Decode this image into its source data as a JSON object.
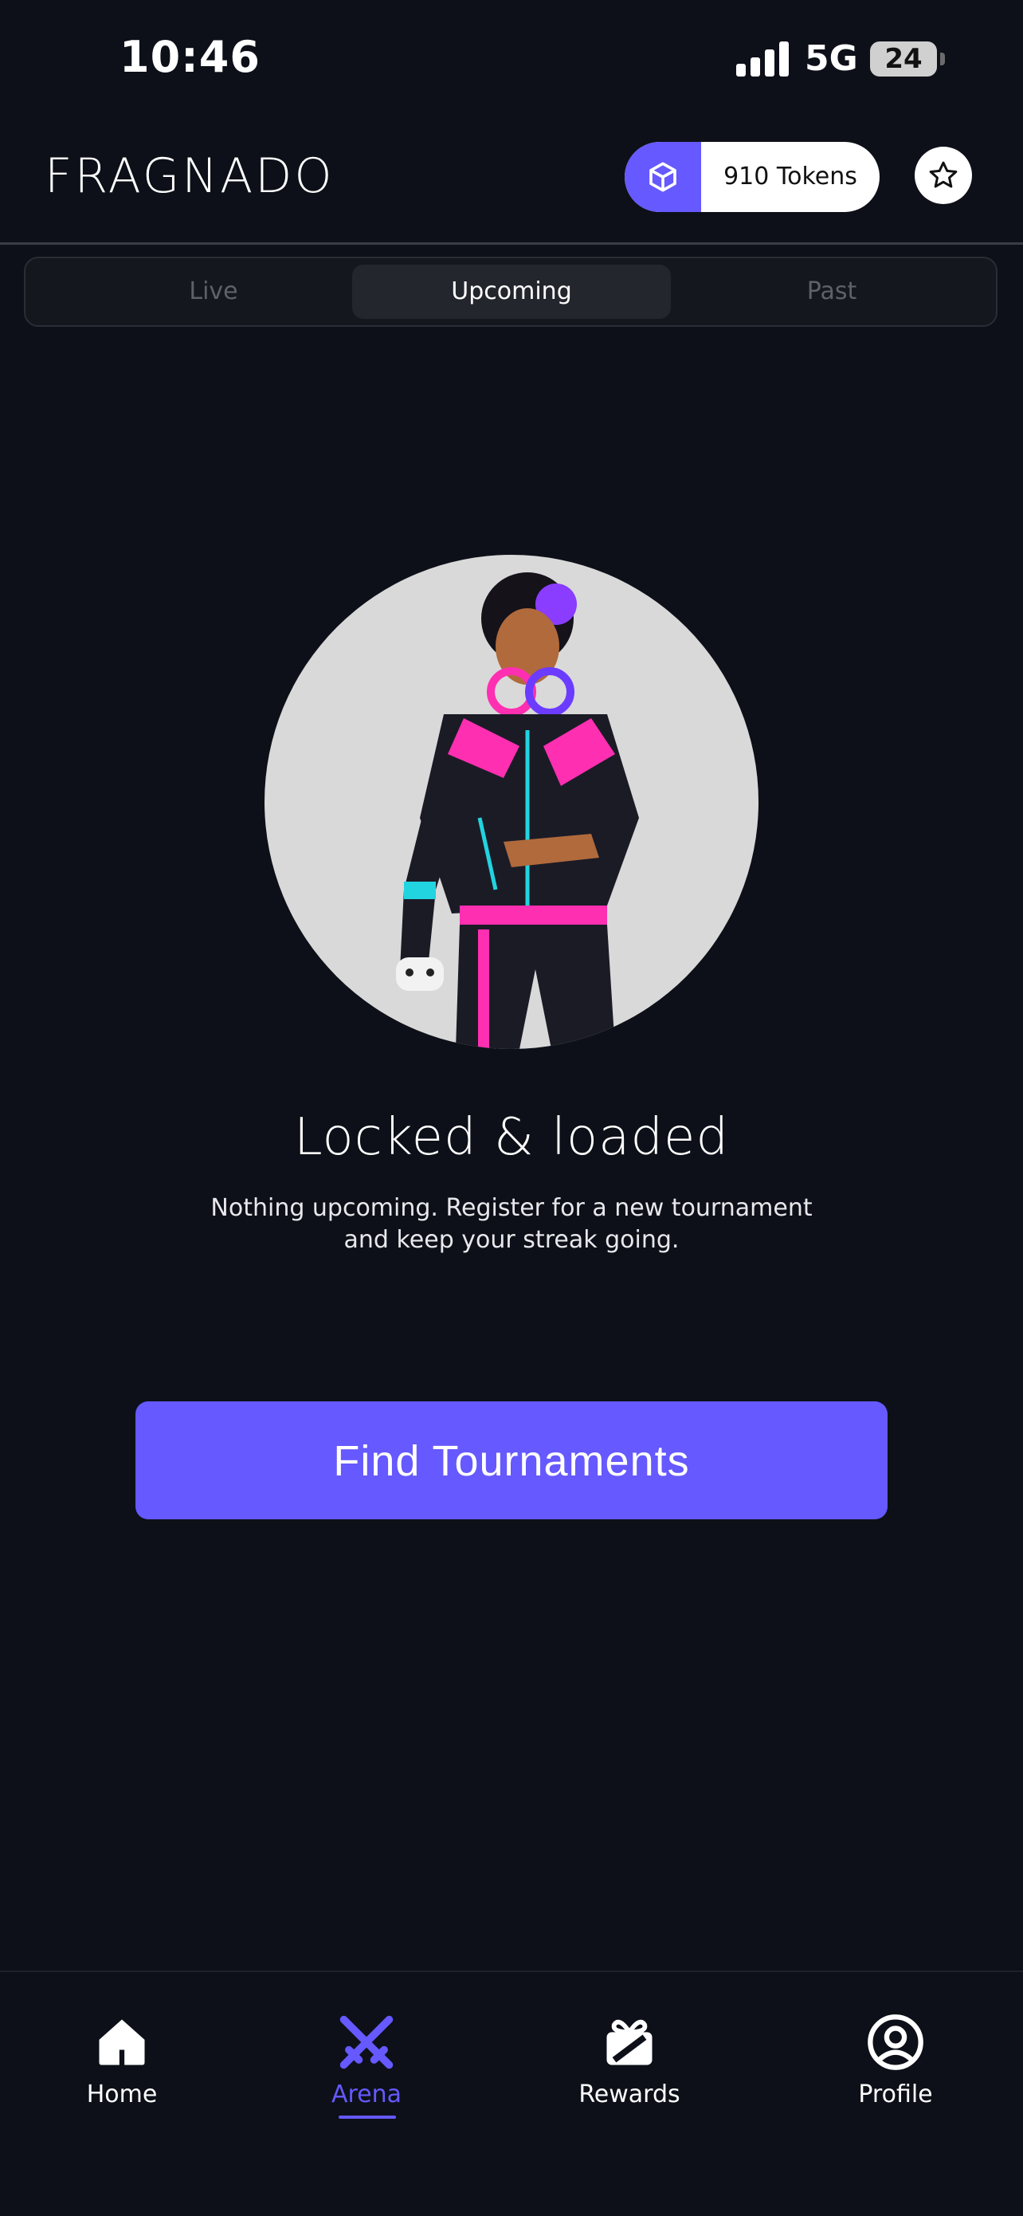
{
  "status_bar": {
    "time": "10:46",
    "network": "5G",
    "battery": "24"
  },
  "header": {
    "brand": "FRAGNADO",
    "tokens": "910 Tokens",
    "token_icon": "cube-icon",
    "favorites_icon": "star-icon"
  },
  "tabs": [
    {
      "label": "Live",
      "active": false
    },
    {
      "label": "Upcoming",
      "active": true
    },
    {
      "label": "Past",
      "active": false
    }
  ],
  "empty_state": {
    "illustration": "gamer-character-illustration",
    "title": "Locked & loaded",
    "message_line1": "Nothing upcoming. Register for a new tournament",
    "message_line2": "and keep your streak going."
  },
  "cta": {
    "label": "Find Tournaments"
  },
  "bottom_nav": [
    {
      "label": "Home",
      "icon": "home-icon",
      "active": false
    },
    {
      "label": "Arena",
      "icon": "crossed-swords-icon",
      "active": true
    },
    {
      "label": "Rewards",
      "icon": "gift-icon",
      "active": false
    },
    {
      "label": "Profile",
      "icon": "user-circle-icon",
      "active": false
    }
  ],
  "colors": {
    "accent": "#6559ff",
    "background": "#0d1018"
  }
}
